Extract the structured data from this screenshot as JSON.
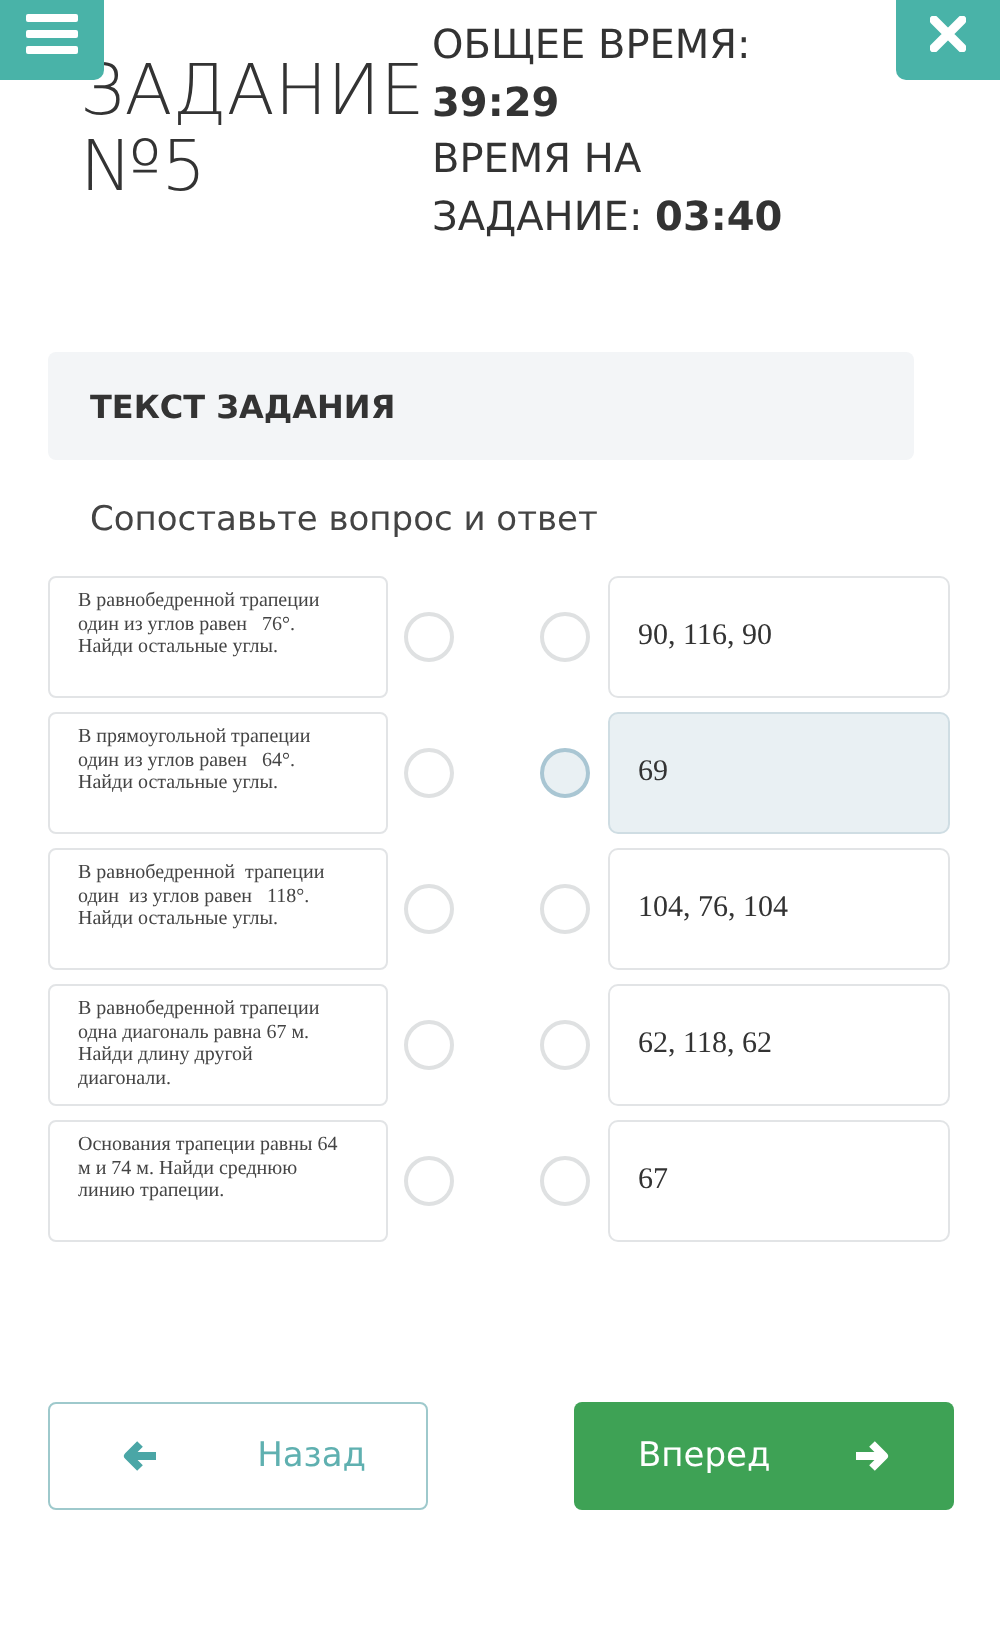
{
  "header": {
    "title_lines": [
      "ЗАДАНИЕ",
      "№5"
    ],
    "total_time_label": "ОБЩЕЕ ВРЕМЯ:",
    "total_time": "39:29",
    "task_time_label_lines": [
      "ВРЕМЯ НА",
      "ЗАДАНИЕ:"
    ],
    "task_time": "03:40"
  },
  "task": {
    "heading": "ТЕКСТ ЗАДАНИЯ",
    "prompt": "Сопоставьте вопрос и ответ"
  },
  "questions": [
    {
      "text": "В равнобедренной трапеции один из углов равен   76°. Найди остальные углы.",
      "selected": false
    },
    {
      "text": "В прямоугольной трапеции один из углов равен   64°. Найди остальные углы.",
      "selected": false
    },
    {
      "text": "В равнобедренной  трапеции один  из углов равен   118°. Найди остальные углы.",
      "selected": false
    },
    {
      "text": "В равнобедренной трапеции одна диагональ равна 67 м. Найди длину другой диагонали.",
      "selected": false
    },
    {
      "text": "Основания трапеции равны 64 м и 74 м. Найди среднюю линию трапеции.",
      "selected": false
    }
  ],
  "answers": [
    {
      "text": "90, 116, 90",
      "selected": false
    },
    {
      "text": "69",
      "selected": true
    },
    {
      "text": "104, 76, 104",
      "selected": false
    },
    {
      "text": "62, 118, 62",
      "selected": false
    },
    {
      "text": "67",
      "selected": false
    }
  ],
  "buttons": {
    "back": "Назад",
    "next": "Вперед"
  }
}
